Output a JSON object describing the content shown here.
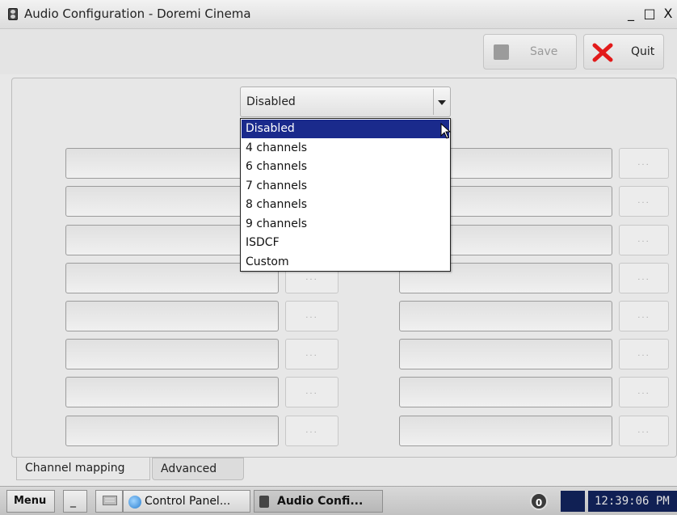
{
  "window": {
    "title": "Audio Configuration - Doremi Cinema",
    "controls": {
      "minimize": "_",
      "maximize": "□",
      "close": "X"
    }
  },
  "toolbar": {
    "save_label": "Save",
    "quit_label": "Quit",
    "save_enabled": false,
    "quit_icon": "red-x-icon",
    "save_icon": "gray-square-icon"
  },
  "combo": {
    "value": "Disabled",
    "options": [
      "Disabled",
      "4 channels",
      "6 channels",
      "7 channels",
      "8 channels",
      "9 channels",
      "ISDCF",
      "Custom"
    ],
    "highlighted_index": 0
  },
  "channel_rows": {
    "count_per_column": 8,
    "button_label": "..."
  },
  "tabs": [
    {
      "label": "Channel mapping",
      "active": true
    },
    {
      "label": "Advanced",
      "active": false
    }
  ],
  "taskbar": {
    "menu_label": "Menu",
    "minimize_label": "_",
    "tasks": [
      "Control Panel...",
      "Audio Confi..."
    ],
    "tray_badge": "0",
    "clock": "12:39:06 PM"
  },
  "colors": {
    "selection": "#1a2a8c",
    "clock_bg": "#102054",
    "quit_red": "#e21a1a"
  }
}
